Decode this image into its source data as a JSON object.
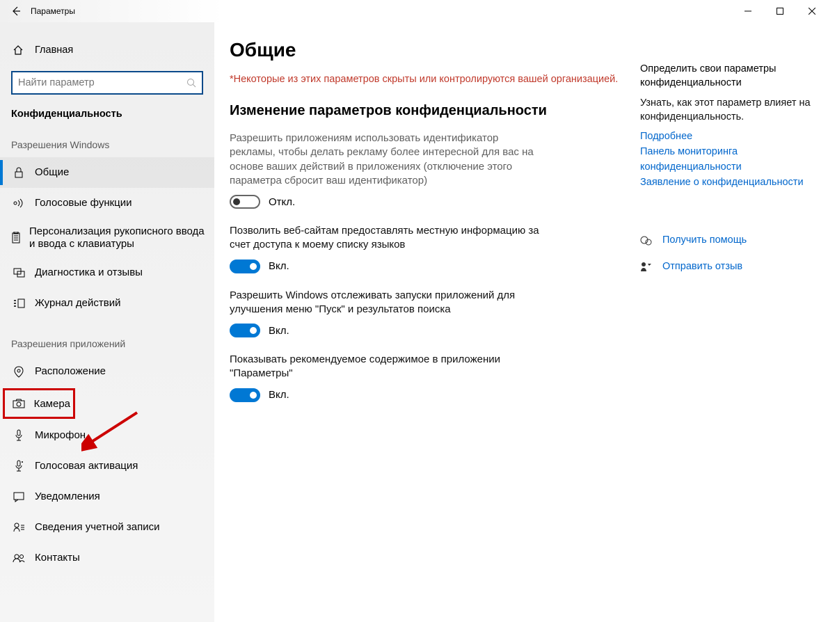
{
  "window": {
    "title": "Параметры"
  },
  "sidebar": {
    "home": "Главная",
    "search_placeholder": "Найти параметр",
    "section": "Конфиденциальность",
    "group_windows": "Разрешения Windows",
    "group_apps": "Разрешения приложений",
    "items_windows": [
      {
        "label": "Общие",
        "active": true
      },
      {
        "label": "Голосовые функции"
      },
      {
        "label": "Персонализация рукописного ввода и ввода с клавиатуры",
        "multi": true
      },
      {
        "label": "Диагностика и отзывы"
      },
      {
        "label": "Журнал действий"
      }
    ],
    "items_apps": [
      {
        "label": "Расположение"
      },
      {
        "label": "Камера",
        "highlight": true
      },
      {
        "label": "Микрофон"
      },
      {
        "label": "Голосовая активация"
      },
      {
        "label": "Уведомления"
      },
      {
        "label": "Сведения учетной записи"
      },
      {
        "label": "Контакты"
      }
    ]
  },
  "content": {
    "title": "Общие",
    "warning": "*Некоторые из этих параметров скрыты или контролируются вашей организацией.",
    "subtitle": "Изменение параметров конфиденциальности",
    "settings": [
      {
        "desc": "Разрешить приложениям использовать идентификатор рекламы, чтобы делать рекламу более интересной для вас на основе ваших действий в приложениях (отключение этого параметра сбросит ваш идентификатор)",
        "on": false,
        "state_label": "Откл.",
        "gray": true
      },
      {
        "desc": "Позволить веб-сайтам предоставлять местную информацию за счет доступа к моему списку языков",
        "on": true,
        "state_label": "Вкл."
      },
      {
        "desc": "Разрешить Windows отслеживать запуски приложений для улучшения меню \"Пуск\" и результатов поиска",
        "on": true,
        "state_label": "Вкл."
      },
      {
        "desc": "Показывать рекомендуемое содержимое в приложении \"Параметры\"",
        "on": true,
        "state_label": "Вкл."
      }
    ]
  },
  "rightcol": {
    "h1": "Определить свои параметры конфиденциальности",
    "p1": "Узнать, как этот параметр влияет на конфиденциальность.",
    "links": [
      "Подробнее",
      "Панель мониторинга конфиденциальности",
      "Заявление о конфиденциальности"
    ],
    "help": "Получить помощь",
    "feedback": "Отправить отзыв"
  }
}
